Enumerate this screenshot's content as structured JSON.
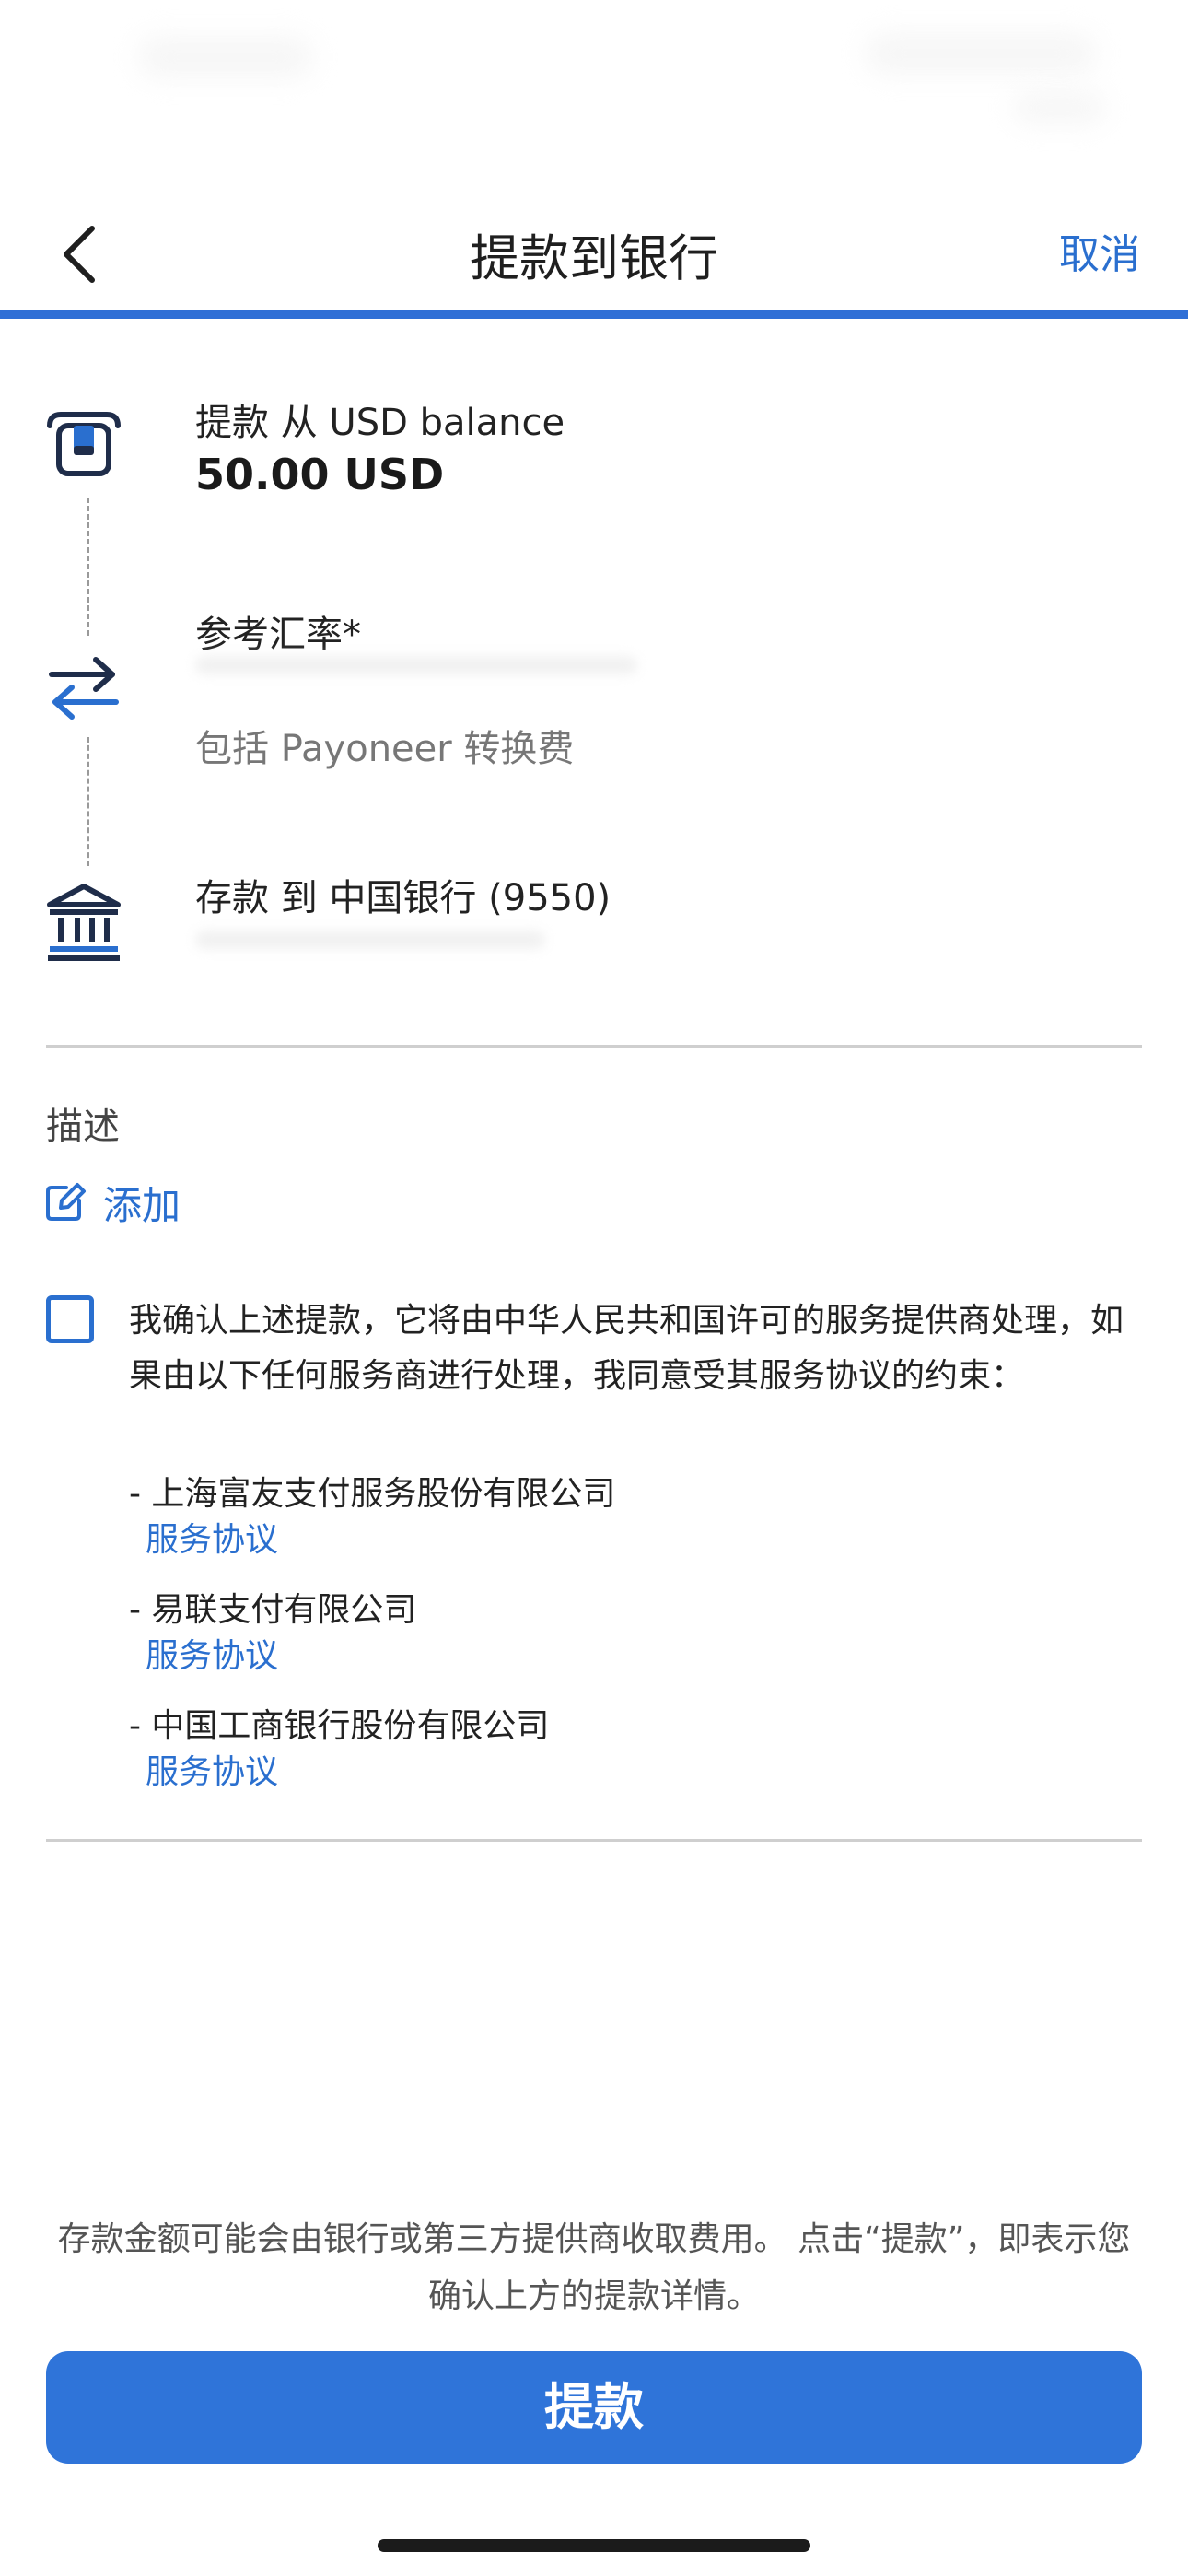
{
  "nav": {
    "back_icon": "chevron-left-icon",
    "title": "提款到银行",
    "cancel_label": "取消"
  },
  "steps": {
    "withdraw": {
      "icon": "wallet-icon",
      "label": "提款 从 USD balance",
      "amount": "50.00 USD"
    },
    "rate": {
      "icon": "exchange-arrows-icon",
      "label": "参考汇率*",
      "fee_note": "包括 Payoneer 转换费"
    },
    "deposit": {
      "icon": "bank-icon",
      "label": "存款 到 中国银行 (9550)"
    }
  },
  "description": {
    "label": "描述",
    "add_icon": "edit-icon",
    "add_label": "添加"
  },
  "consent": {
    "checked": false,
    "text": "我确认上述提款，它将由中华人民共和国许可的服务提供商处理，如果由以下任何服务商进行处理，我同意受其服务协议的约束："
  },
  "providers": [
    {
      "name": "- 上海富友支付服务股份有限公司",
      "link": "服务协议"
    },
    {
      "name": "- 易联支付有限公司",
      "link": "服务协议"
    },
    {
      "name": "- 中国工商银行股份有限公司",
      "link": "服务协议"
    }
  ],
  "footer": {
    "note": "存款金额可能会由银行或第三方提供商收取费用。 点击“提款”，即表示您确认上方的提款详情。",
    "submit_label": "提款"
  },
  "colors": {
    "accent": "#2f74d9",
    "link": "#2a6fcf"
  }
}
